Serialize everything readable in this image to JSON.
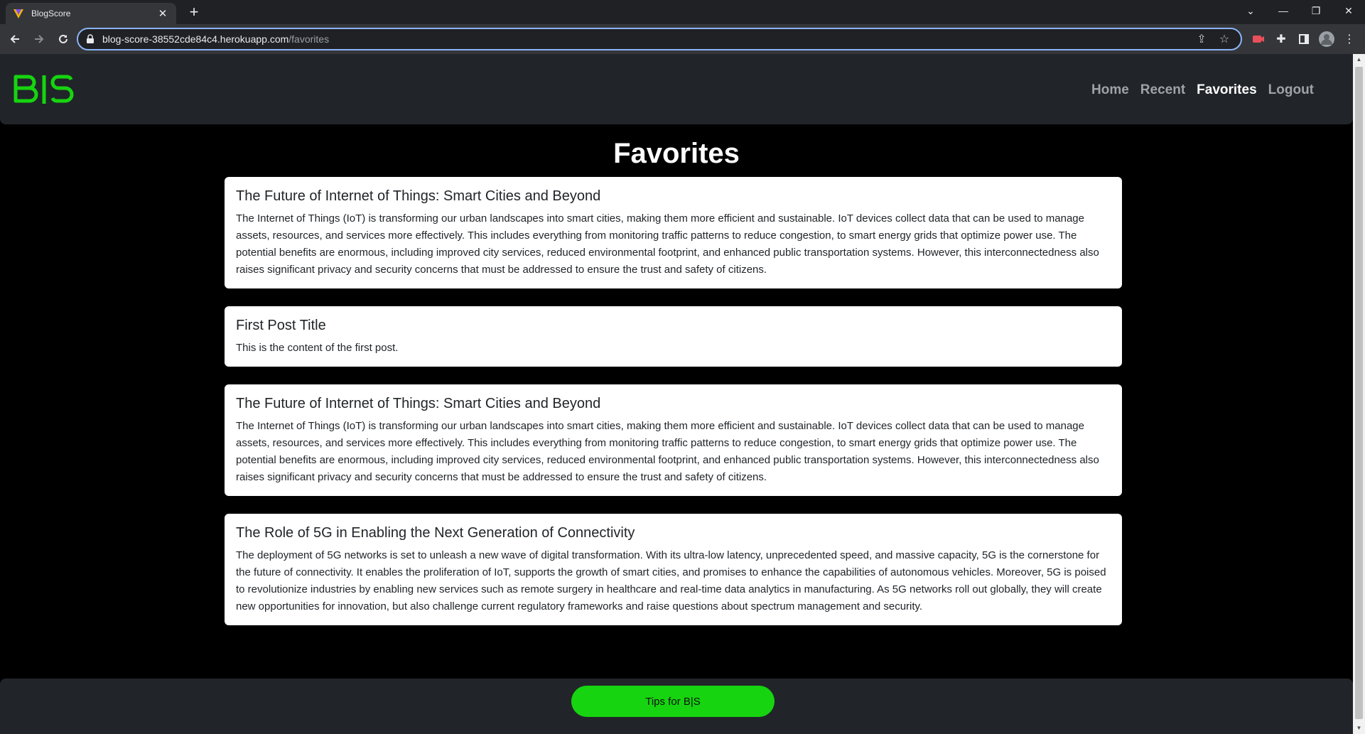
{
  "browser": {
    "tab_title": "BlogScore",
    "url_host": "blog-score-38552cde84c4.herokuapp.com",
    "url_path": "/favorites"
  },
  "site": {
    "logo_text": "B|S",
    "brand_color": "#16d410",
    "nav": [
      {
        "label": "Home",
        "active": false
      },
      {
        "label": "Recent",
        "active": false
      },
      {
        "label": "Favorites",
        "active": true
      },
      {
        "label": "Logout",
        "active": false
      }
    ]
  },
  "page": {
    "title": "Favorites",
    "posts": [
      {
        "title": "The Future of Internet of Things: Smart Cities and Beyond",
        "content": "The Internet of Things (IoT) is transforming our urban landscapes into smart cities, making them more efficient and sustainable. IoT devices collect data that can be used to manage assets, resources, and services more effectively. This includes everything from monitoring traffic patterns to reduce congestion, to smart energy grids that optimize power use. The potential benefits are enormous, including improved city services, reduced environmental footprint, and enhanced public transportation systems. However, this interconnectedness also raises significant privacy and security concerns that must be addressed to ensure the trust and safety of citizens."
      },
      {
        "title": "First Post Title",
        "content": "This is the content of the first post."
      },
      {
        "title": "The Future of Internet of Things: Smart Cities and Beyond",
        "content": "The Internet of Things (IoT) is transforming our urban landscapes into smart cities, making them more efficient and sustainable. IoT devices collect data that can be used to manage assets, resources, and services more effectively. This includes everything from monitoring traffic patterns to reduce congestion, to smart energy grids that optimize power use. The potential benefits are enormous, including improved city services, reduced environmental footprint, and enhanced public transportation systems. However, this interconnectedness also raises significant privacy and security concerns that must be addressed to ensure the trust and safety of citizens."
      },
      {
        "title": "The Role of 5G in Enabling the Next Generation of Connectivity",
        "content": "The deployment of 5G networks is set to unleash a new wave of digital transformation. With its ultra-low latency, unprecedented speed, and massive capacity, 5G is the cornerstone for the future of connectivity. It enables the proliferation of IoT, supports the growth of smart cities, and promises to enhance the capabilities of autonomous vehicles. Moreover, 5G is poised to revolutionize industries by enabling new services such as remote surgery in healthcare and real-time data analytics in manufacturing. As 5G networks roll out globally, they will create new opportunities for innovation, but also challenge current regulatory frameworks and raise questions about spectrum management and security."
      }
    ]
  },
  "footer": {
    "tips_label": "Tips for B|S"
  }
}
